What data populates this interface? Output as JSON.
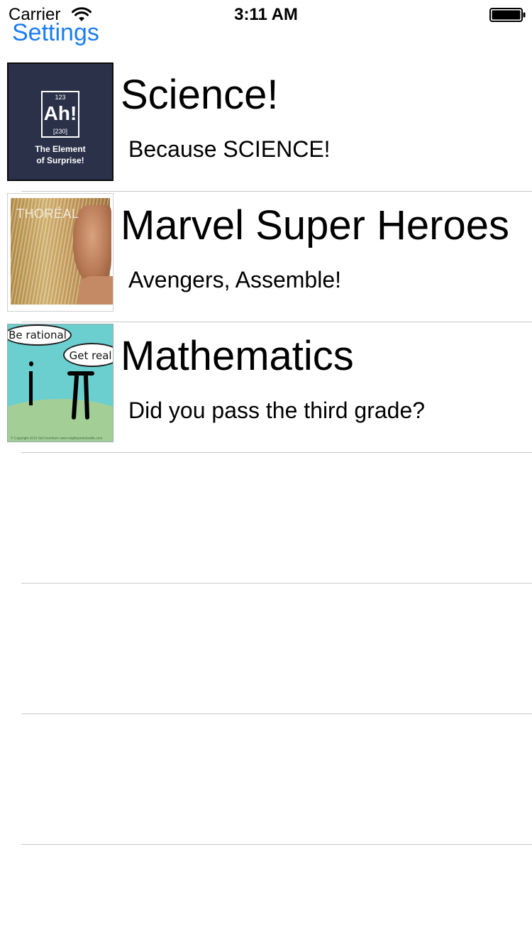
{
  "status_bar": {
    "carrier": "Carrier",
    "time": "3:11 AM"
  },
  "nav": {
    "back_label": "Settings"
  },
  "rows": [
    {
      "title": "Science!",
      "subtitle": "Because SCIENCE!",
      "thumb": {
        "element_number": "123",
        "element_symbol": "Ah!",
        "element_mass": "[230]",
        "caption_line1": "The Element",
        "caption_line2": "of Surprise!"
      }
    },
    {
      "title": "Marvel Super Heroes",
      "subtitle": "Avengers, Assemble!",
      "thumb": {
        "overlay_text": "THORÉAL"
      }
    },
    {
      "title": "Mathematics",
      "subtitle": "Did you pass the third grade?",
      "thumb": {
        "bubble1": "Be rational",
        "bubble2": "Get real.",
        "copyright": "© Copyright 2010 Sid Gronheim      www.mightyantedoodle.com"
      }
    }
  ],
  "colors": {
    "tint": "#1a7cf4",
    "separator": "#c8c7cc",
    "science_bg": "#2b3148",
    "math_sky": "#6bcfd0",
    "math_grass": "#a3cf96"
  }
}
